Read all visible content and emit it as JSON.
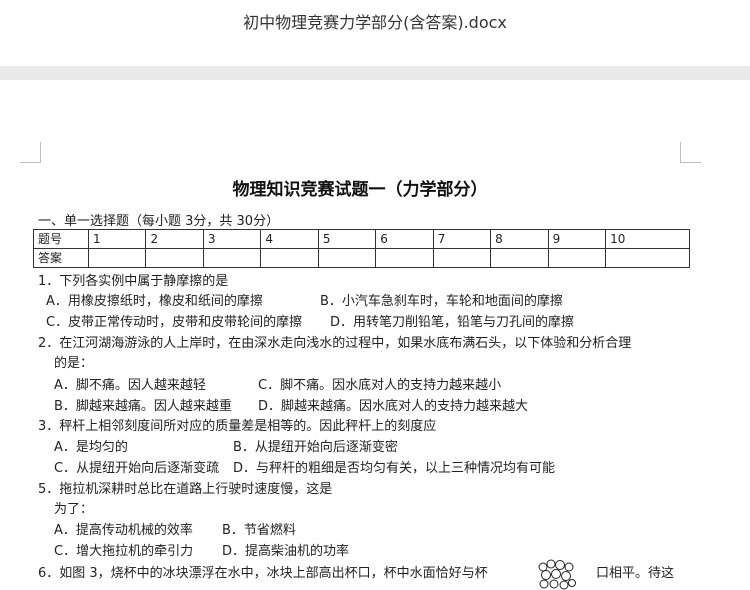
{
  "window": {
    "file_title": "初中物理竞赛力学部分(含答案).docx"
  },
  "doc": {
    "title": "物理知识竞赛试题一（力学部分）",
    "section": "一、单一选择题（每小题 3分，共 30分）",
    "table": {
      "row1": [
        "题号",
        "1",
        "2",
        "3",
        "4",
        "5",
        "6",
        "7",
        "8",
        "9",
        "10"
      ],
      "row2": [
        "答案",
        "",
        "",
        "",
        "",
        "",
        "",
        "",
        "",
        "",
        ""
      ]
    },
    "q1": {
      "stem": "1．下列各实例中属于静摩擦的是",
      "a": "A．用橡皮擦纸时，橡皮和纸间的摩擦",
      "b": "B．小汽车急刹车时，车轮和地面间的摩擦",
      "c": "C．皮带正常传动时，皮带和皮带轮间的摩擦",
      "d": "D．用转笔刀削铅笔，铅笔与刀孔间的摩擦"
    },
    "q2": {
      "stem1": "2．在江河湖海游泳的人上岸时，在由深水走向浅水的过程中，如果水底布满石头，以下体验和分析合理",
      "stem2": "的是：",
      "a": "A．脚不痛。因人越来越轻",
      "c": "C．脚不痛。因水底对人的支持力越来越小",
      "b": "B．脚越来越痛。因人越来越重",
      "d": "D．脚越来越痛。因水底对人的支持力越来越大"
    },
    "q3": {
      "stem": "3．秤杆上相邻刻度间所对应的质量差是相等的。因此秤杆上的刻度应",
      "a": "A．是均匀的",
      "b": "B．从提纽开始向后逐渐变密",
      "c": "C．从提纽开始向后逐渐变疏",
      "d": "D．与秤杆的粗细是否均匀有关，以上三种情况均有可能"
    },
    "q5": {
      "stem1": "5．拖拉机深耕时总比在道路上行驶时速度慢，这是",
      "stem2": "为了：",
      "a": "A．提高传动机械的效率",
      "b": "B．节省燃料",
      "c": "C．增大拖拉机的牵引力",
      "d": "D．提高柴油机的功率"
    },
    "q6": {
      "stem_left": "6．如图 3，烧杯中的冰块漂浮在水中，冰块上部高出杯口，杯中水面恰好与杯",
      "stem_right": "口相平。待这"
    }
  }
}
